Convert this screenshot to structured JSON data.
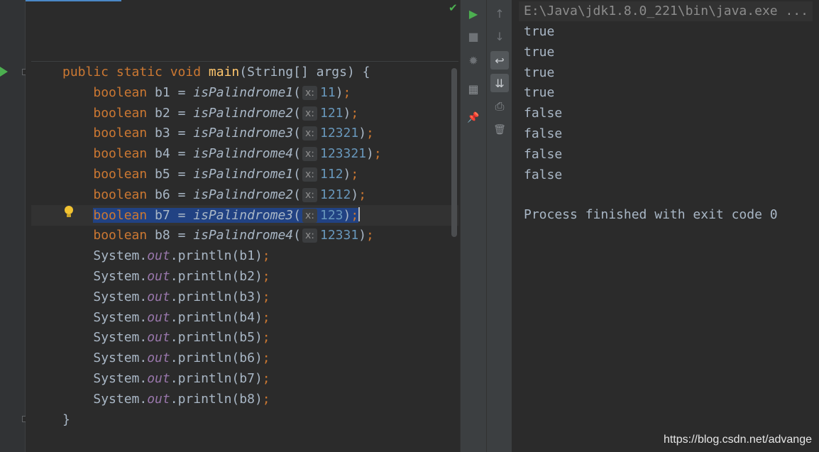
{
  "editor": {
    "lines": [
      {
        "tokens": [
          [
            "kw",
            "public static void "
          ],
          [
            "fn",
            "main"
          ],
          [
            "plain",
            "(String[] args) {"
          ]
        ]
      },
      {
        "indent": 2,
        "type": "assign",
        "var": "b1",
        "method": "isPalindrome1",
        "hint": "x:",
        "arg": "11"
      },
      {
        "indent": 2,
        "type": "assign",
        "var": "b2",
        "method": "isPalindrome2",
        "hint": "x:",
        "arg": "121"
      },
      {
        "indent": 2,
        "type": "assign",
        "var": "b3",
        "method": "isPalindrome3",
        "hint": "x:",
        "arg": "12321"
      },
      {
        "indent": 2,
        "type": "assign",
        "var": "b4",
        "method": "isPalindrome4",
        "hint": "x:",
        "arg": "123321"
      },
      {
        "indent": 2,
        "type": "assign",
        "var": "b5",
        "method": "isPalindrome1",
        "hint": "x:",
        "arg": "112"
      },
      {
        "indent": 2,
        "type": "assign",
        "var": "b6",
        "method": "isPalindrome2",
        "hint": "x:",
        "arg": "1212"
      },
      {
        "indent": 2,
        "type": "assign",
        "var": "b7",
        "method": "isPalindrome3",
        "hint": "x:",
        "arg": "123",
        "selected": true
      },
      {
        "indent": 2,
        "type": "assign",
        "var": "b8",
        "method": "isPalindrome4",
        "hint": "x:",
        "arg": "12331"
      },
      {
        "indent": 2,
        "type": "print",
        "var": "b1"
      },
      {
        "indent": 2,
        "type": "print",
        "var": "b2"
      },
      {
        "indent": 2,
        "type": "print",
        "var": "b3"
      },
      {
        "indent": 2,
        "type": "print",
        "var": "b4"
      },
      {
        "indent": 2,
        "type": "print",
        "var": "b5"
      },
      {
        "indent": 2,
        "type": "print",
        "var": "b6"
      },
      {
        "indent": 2,
        "type": "print",
        "var": "b7"
      },
      {
        "indent": 2,
        "type": "print",
        "var": "b8"
      },
      {
        "tokens": [
          [
            "plain",
            "}"
          ]
        ]
      }
    ],
    "keyword_boolean": "boolean",
    "system": "System.",
    "out": "out",
    "println": ".println(",
    "close": ");"
  },
  "console": {
    "command": "E:\\Java\\jdk1.8.0_221\\bin\\java.exe ...",
    "output": [
      "true",
      "true",
      "true",
      "true",
      "false",
      "false",
      "false",
      "false"
    ],
    "exit_message": "Process finished with exit code 0"
  },
  "watermark": "https://blog.csdn.net/advange",
  "icons": {
    "run": "▶",
    "stop": "■",
    "debug": "✹",
    "layout": "▦",
    "pin": "📌",
    "up": "↑",
    "down": "↓",
    "wrap": "↩",
    "scroll_end": "⇊",
    "print": "⎙",
    "trash": "🗑"
  },
  "colors": {
    "keyword": "#cc7832",
    "function": "#ffc66d",
    "number": "#6897bb",
    "field": "#9876aa",
    "run": "#4caf50"
  }
}
